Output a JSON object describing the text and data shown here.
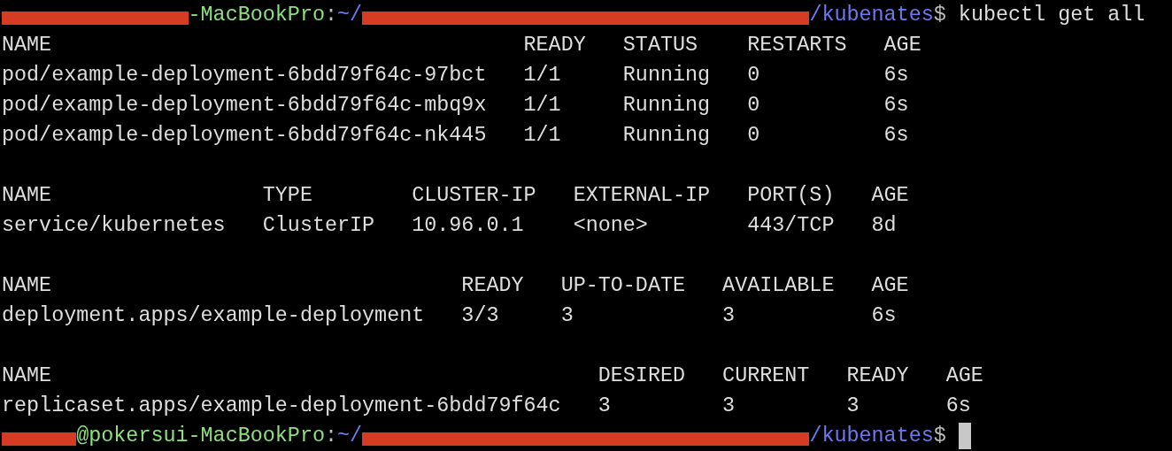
{
  "command_line": {
    "prompt": {
      "user_host": "-MacBookPro",
      "separator": ":",
      "path_start": "~/",
      "path_end": "/kubenates",
      "symbol": "$"
    },
    "command": "kubectl get all"
  },
  "tables": [
    {
      "columns": [
        "NAME",
        "READY",
        "STATUS",
        "RESTARTS",
        "AGE"
      ],
      "rows": [
        [
          "pod/example-deployment-6bdd79f64c-97bct",
          "1/1",
          "Running",
          "0",
          "6s"
        ],
        [
          "pod/example-deployment-6bdd79f64c-mbq9x",
          "1/1",
          "Running",
          "0",
          "6s"
        ],
        [
          "pod/example-deployment-6bdd79f64c-nk445",
          "1/1",
          "Running",
          "0",
          "6s"
        ]
      ]
    },
    {
      "columns": [
        "NAME",
        "TYPE",
        "CLUSTER-IP",
        "EXTERNAL-IP",
        "PORT(S)",
        "AGE"
      ],
      "rows": [
        [
          "service/kubernetes",
          "ClusterIP",
          "10.96.0.1",
          "<none>",
          "443/TCP",
          "8d"
        ]
      ]
    },
    {
      "columns": [
        "NAME",
        "READY",
        "UP-TO-DATE",
        "AVAILABLE",
        "AGE"
      ],
      "rows": [
        [
          "deployment.apps/example-deployment",
          "3/3",
          "3",
          "3",
          "6s"
        ]
      ]
    },
    {
      "columns": [
        "NAME",
        "DESIRED",
        "CURRENT",
        "READY",
        "AGE"
      ],
      "rows": [
        [
          "replicaset.apps/example-deployment-6bdd79f64c",
          "3",
          "3",
          "3",
          "6s"
        ]
      ]
    }
  ],
  "final_prompt": {
    "prompt": {
      "user_host": "@pokersui-MacBookPro",
      "separator": ":",
      "path_start": "~/",
      "path_end": "/kubenates",
      "symbol": "$"
    },
    "cursor": true
  }
}
